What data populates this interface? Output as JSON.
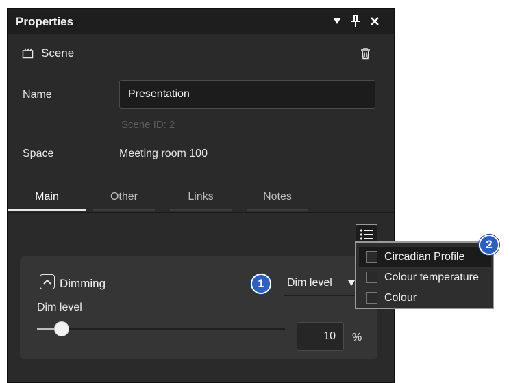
{
  "panel": {
    "title": "Properties",
    "header": {
      "icon": "scene-icon",
      "label": "Scene"
    },
    "name": {
      "label": "Name",
      "value": "Presentation"
    },
    "scene_id": "Scene ID: 2",
    "space": {
      "label": "Space",
      "value": "Meeting room 100"
    },
    "tabs": [
      {
        "label": "Main",
        "active": true
      },
      {
        "label": "Other",
        "active": false
      },
      {
        "label": "Links",
        "active": false
      },
      {
        "label": "Notes",
        "active": false
      }
    ],
    "dimming": {
      "title": "Dimming",
      "mode": "Dim level",
      "slider_label": "Dim level",
      "value": "10",
      "unit": "%",
      "level_percent": 10
    }
  },
  "dropdown": {
    "items": [
      {
        "label": "Circadian Profile",
        "checked": false,
        "highlighted": true
      },
      {
        "label": "Colour temperature",
        "checked": false,
        "highlighted": false
      },
      {
        "label": "Colour",
        "checked": false,
        "highlighted": false
      }
    ]
  },
  "callouts": [
    "1",
    "2"
  ],
  "colors": {
    "panel_bg": "#2a2a2a",
    "title_bg": "#1e1e1e",
    "group_bg": "#353535",
    "callout": "#2d5fbf"
  }
}
